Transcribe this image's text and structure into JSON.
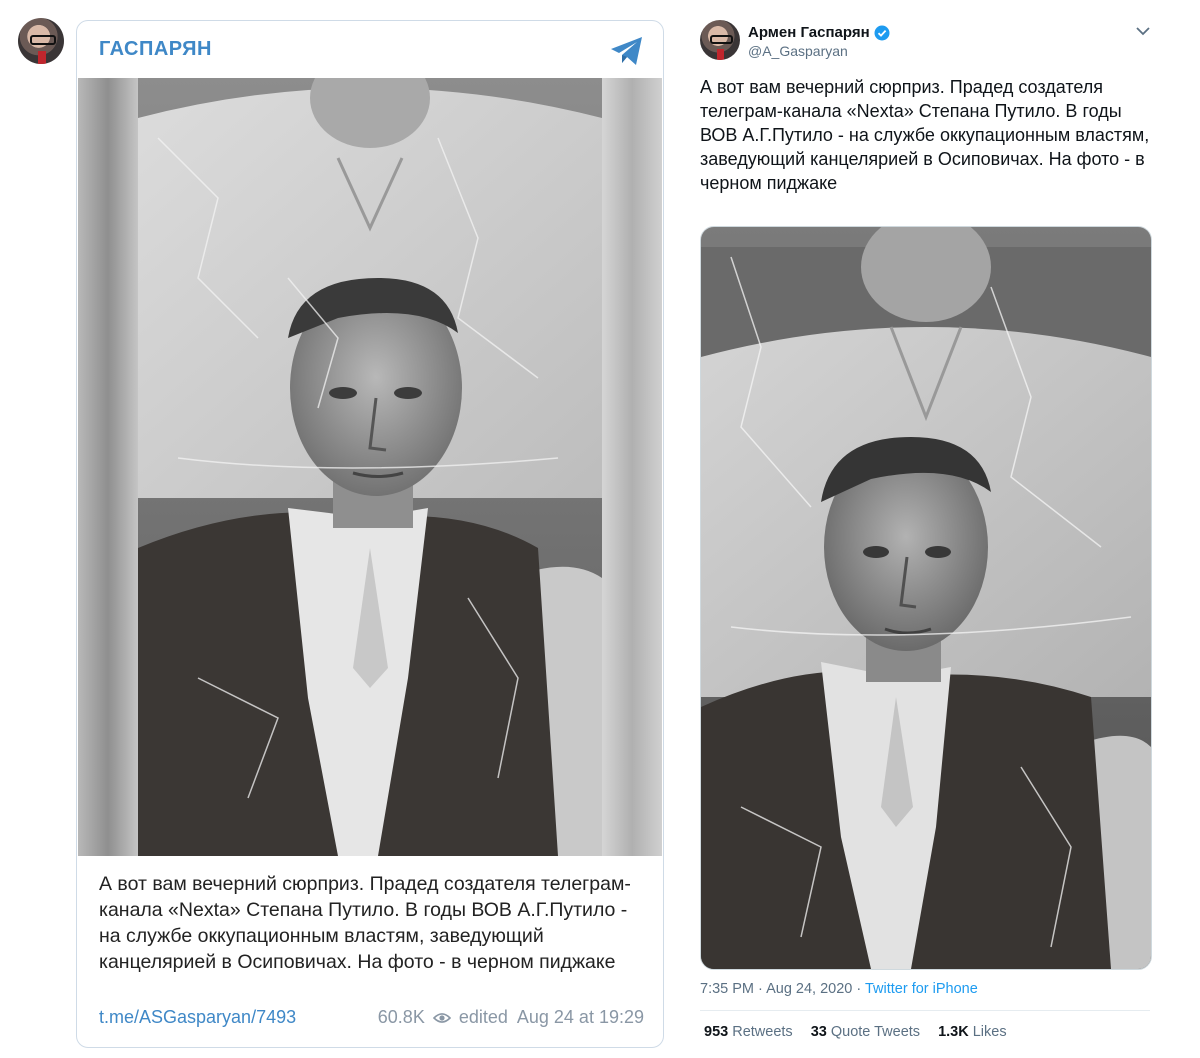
{
  "telegram": {
    "channel_name": "ГАСПАРЯН",
    "message": "А вот вам вечерний сюрприз. Прадед создателя телеграм-канала «Nexta» Степана Путило. В годы ВОВ А.Г.Путило - на службе оккупационным властям, заведующий канцелярией в Осиповичах. На фото - в черном пиджаке",
    "link": "t.me/ASGasparyan/7493",
    "views": "60.8K",
    "edited": "edited  Aug 24 at 19:29",
    "accent_color": "#3f88c7",
    "icons": [
      "telegram-plane-icon",
      "eye-icon"
    ]
  },
  "twitter": {
    "display_name": "Армен Гаспарян",
    "handle": "@A_Gasparyan",
    "tweet_text": "А вот вам вечерний сюрприз. Прадед создателя телеграм-канала «Nexta» Степана Путило. В годы ВОВ А.Г.Путило - на службе оккупационным властям, заведующий канцелярией в Осиповичах. На фото - в черном пиджаке",
    "timestamp": "7:35 PM · Aug 24, 2020 · ",
    "source": "Twitter for iPhone",
    "retweets_count": "953",
    "retweets_label": "Retweets",
    "quote_count": "33",
    "quote_label": "Quote Tweets",
    "likes_count": "1.3K",
    "likes_label": "Likes",
    "accent_color": "#1d9bf0",
    "icons": [
      "verified-badge-icon",
      "chevron-down-icon"
    ]
  }
}
